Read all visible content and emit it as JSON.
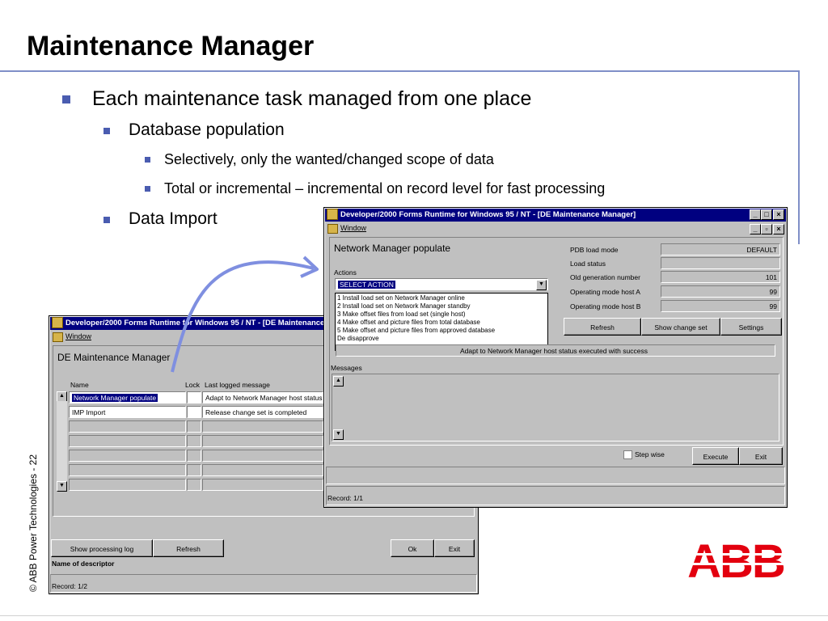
{
  "slide": {
    "title": "Maintenance Manager",
    "bullets": [
      "Each maintenance task managed from one place",
      "Database population",
      "Selectively, only the wanted/changed scope of data",
      "Total or incremental – incremental on record level for fast processing",
      "Data Import"
    ],
    "side_credit": "© ABB Power Technologies - 22",
    "logo_text": "ABB",
    "arrow_color": "#7f8fe0",
    "accent_color": "#4a5cb0",
    "logo_color": "#e3000f"
  },
  "back_window": {
    "title": "Developer/2000 Forms Runtime for Windows 95 / NT - [DE Maintenance M",
    "menu_label": "Window",
    "heading": "DE Maintenance Manager",
    "columns": [
      "Name",
      "Lock",
      "Last logged message"
    ],
    "rows": [
      {
        "name": "Network Manager populate",
        "lock": "",
        "message": "Adapt to Network Manager host status"
      },
      {
        "name": "IMP Import",
        "lock": "",
        "message": "Release change set is completed"
      }
    ],
    "buttons": {
      "log": "Show processing log",
      "refresh": "Refresh",
      "ok": "Ok",
      "exit": "Exit"
    },
    "descriptor_label": "Name of descriptor",
    "status": "Record: 1/2"
  },
  "front_window": {
    "title": "Developer/2000 Forms Runtime for Windows 95 / NT - [DE Maintenance Manager]",
    "menu_label": "Window",
    "heading": "Network Manager populate",
    "actions_label": "Actions",
    "select_value": "SELECT ACTION",
    "dropdown_options": [
      "1   Install load set on Network Manager online",
      "2   Install load set on Network Manager standby",
      "3   Make offset  files from load set (single host)",
      "4   Make offset and picture files from total database",
      "5   Make offset and picture files from approved database",
      "De disapprove"
    ],
    "info_fields": [
      {
        "label": "PDB load mode",
        "value": "DEFAULT"
      },
      {
        "label": "Load status",
        "value": ""
      },
      {
        "label": "Old generation number",
        "value": "101"
      },
      {
        "label": "Operating mode host A",
        "value": "99"
      },
      {
        "label": "Operating mode host B",
        "value": "99"
      }
    ],
    "buttons": {
      "refresh": "Refresh",
      "show_change_set": "Show change set",
      "settings": "Settings",
      "execute": "Execute",
      "exit": "Exit"
    },
    "log_message": "Adapt to Network Manager host status executed with success",
    "messages_label": "Messages",
    "step_wise_label": "Step wise",
    "status": "Record: 1/1"
  }
}
